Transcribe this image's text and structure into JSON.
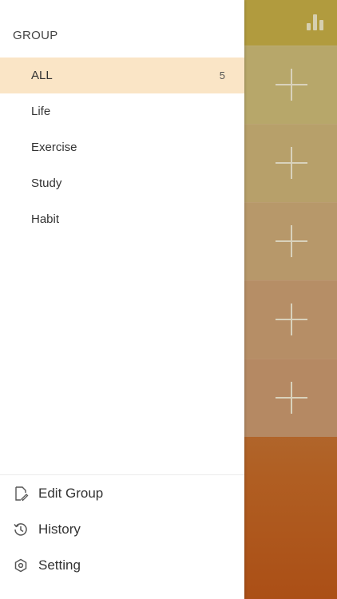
{
  "drawer": {
    "title": "GROUP",
    "groups": [
      {
        "label": "ALL",
        "count": "5"
      },
      {
        "label": "Life"
      },
      {
        "label": "Exercise"
      },
      {
        "label": "Study"
      },
      {
        "label": "Habit"
      }
    ],
    "footer": {
      "edit_group": "Edit Group",
      "history": "History",
      "setting": "Setting"
    }
  },
  "colors": {
    "active_row": "#fae5c6",
    "backdrop_top": "#b59a3a",
    "backdrop_bottom": "#ab4f16"
  },
  "icons": [
    "bar-chart-icon",
    "plus-icon",
    "edit-icon",
    "history-icon",
    "setting-icon"
  ]
}
